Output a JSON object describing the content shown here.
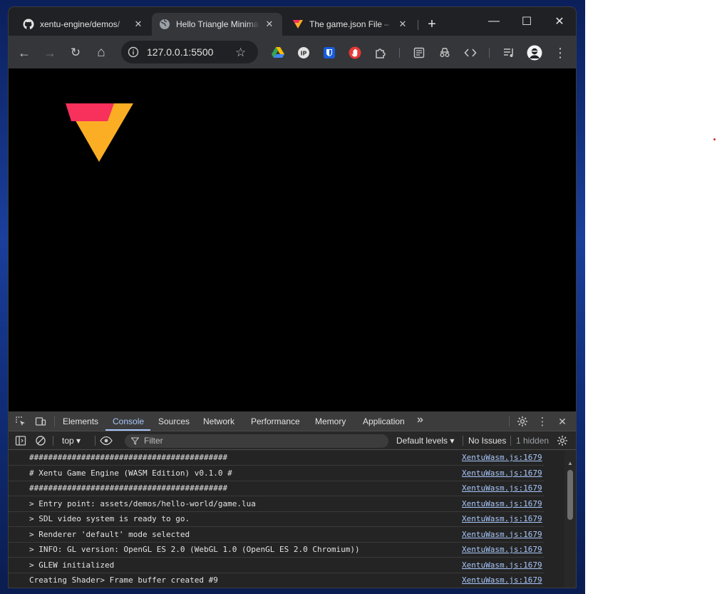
{
  "tabs": [
    {
      "title": "xentu-engine/demos/",
      "favicon": "github-icon",
      "active": false
    },
    {
      "title": "Hello Triangle Minimal",
      "favicon": "globe-icon",
      "active": true
    },
    {
      "title": "The game.json File – X",
      "favicon": "xentu-logo-icon",
      "active": false
    }
  ],
  "window_controls": {
    "minimize": "—",
    "maximize": "☐",
    "close": "✕"
  },
  "toolbar": {
    "url": "127.0.0.1:5500",
    "back": "←",
    "forward": "→",
    "reload": "↻",
    "home": "⌂",
    "star": "☆",
    "menu": "⋮"
  },
  "extensions": [
    "google-drive-icon",
    "ip-icon",
    "bitwarden-icon",
    "hand-icon",
    "puzzle-icon",
    "reading-list-icon",
    "spy-icon",
    "code-icon",
    "media-icon",
    "profile-avatar-icon"
  ],
  "colors": {
    "triangle_top": "#f7305c",
    "triangle_bottom": "#fbae24",
    "devtools_accent": "#a8c7fa"
  },
  "devtools": {
    "tabs": [
      "Elements",
      "Console",
      "Sources",
      "Network",
      "Performance",
      "Memory",
      "Application"
    ],
    "active_tab": "Console",
    "more": "»",
    "context": "top ▾",
    "filter_placeholder": "Filter",
    "levels": "Default levels ▾",
    "issues": "No Issues",
    "hidden": "1 hidden"
  },
  "console": [
    {
      "msg": "##########################################",
      "src": "XentuWasm.js:1679"
    },
    {
      "msg": "# Xentu Game Engine (WASM Edition) v0.1.0 #",
      "src": "XentuWasm.js:1679"
    },
    {
      "msg": "##########################################",
      "src": "XentuWasm.js:1679"
    },
    {
      "msg": "> Entry point: assets/demos/hello-world/game.lua",
      "src": "XentuWasm.js:1679"
    },
    {
      "msg": "> SDL video system is ready to go.",
      "src": "XentuWasm.js:1679"
    },
    {
      "msg": "> Renderer 'default' mode selected",
      "src": "XentuWasm.js:1679"
    },
    {
      "msg": "> INFO: GL version: OpenGL ES 2.0 (WebGL 1.0 (OpenGL ES 2.0 Chromium))",
      "src": "XentuWasm.js:1679"
    },
    {
      "msg": "> GLEW initialized",
      "src": "XentuWasm.js:1679"
    },
    {
      "msg": "Creating Shader> Frame buffer created #9",
      "src": "XentuWasm.js:1679"
    }
  ]
}
